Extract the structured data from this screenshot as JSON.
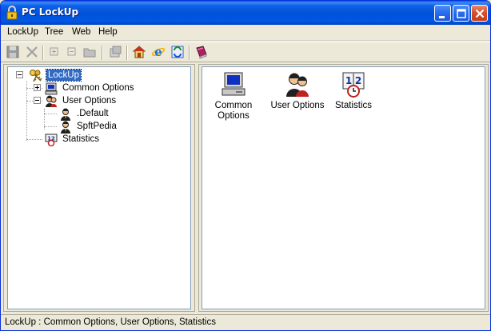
{
  "window": {
    "title": "PC LockUp"
  },
  "menu": [
    "LockUp",
    "Tree",
    "Web",
    "Help"
  ],
  "toolbar": {
    "icons": [
      "save-icon",
      "delete-icon",
      "expand-icon",
      "collapse-icon",
      "folder-icon",
      "properties-icon",
      "home-icon",
      "internet-explorer-icon",
      "refresh-icon",
      "help-book-icon"
    ]
  },
  "tree": {
    "root": "LockUp",
    "children": [
      {
        "label": "Common Options"
      },
      {
        "label": "User Options",
        "children": [
          {
            "label": ".Default"
          },
          {
            "label": "SpftPedia"
          }
        ]
      },
      {
        "label": "Statistics"
      }
    ]
  },
  "content": {
    "items": [
      {
        "label_line1": "Common",
        "label_line2": "Options"
      },
      {
        "label_line1": "User Options",
        "label_line2": ""
      },
      {
        "label_line1": "Statistics",
        "label_line2": ""
      }
    ]
  },
  "status": {
    "text": "LockUp : Common Options, User Options, Statistics"
  },
  "colors": {
    "titlebar": "#0054e3",
    "selection": "#316ac5",
    "pane_border": "#7f9db9"
  }
}
